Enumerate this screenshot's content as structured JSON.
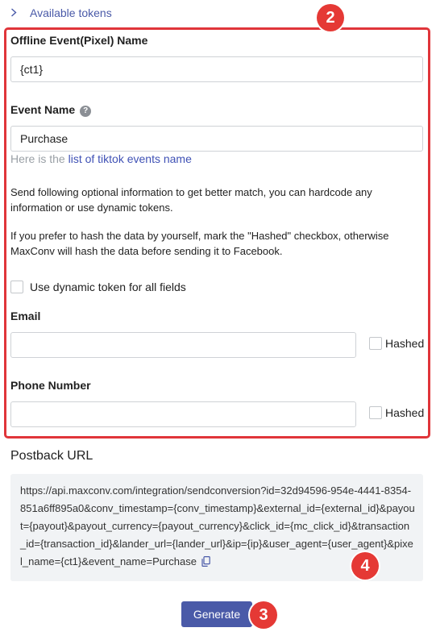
{
  "tokens": {
    "label": "Available tokens"
  },
  "form": {
    "offline_event_label": "Offline Event(Pixel) Name",
    "offline_event_value": "{ct1}",
    "event_name_label": "Event Name",
    "help_glyph": "?",
    "event_name_value": "Purchase",
    "hint_prefix": "Here is the",
    "hint_link": "list of tiktok events name",
    "info_1": "Send following optional information to get better match, you can hardcode any information or use dynamic tokens.",
    "info_2": "If you prefer to hash the data by yourself, mark the \"Hashed\" checkbox, otherwise MaxConv will hash the data before sending it to Facebook.",
    "dynamic_token_label": "Use dynamic token for all fields",
    "email_label": "Email",
    "email_value": "",
    "phone_label": "Phone Number",
    "phone_value": "",
    "hashed_label": "Hashed"
  },
  "postback": {
    "title": "Postback URL",
    "url": "https://api.maxconv.com/integration/sendconversion?id=32d94596-954e-4441-8354-851a6ff895a0&conv_timestamp={conv_timestamp}&external_id={external_id}&payout={payout}&payout_currency={payout_currency}&click_id={mc_click_id}&transaction_id={transaction_id}&lander_url={lander_url}&ip={ip}&user_agent={user_agent}&pixel_name={ct1}&event_name=Purchase"
  },
  "actions": {
    "generate_label": "Generate"
  },
  "annotations": {
    "badge_2": "2",
    "badge_3": "3",
    "badge_4": "4"
  },
  "colors": {
    "accent": "#4a5aa8",
    "highlight": "#e0353a",
    "badge": "#e53935"
  }
}
